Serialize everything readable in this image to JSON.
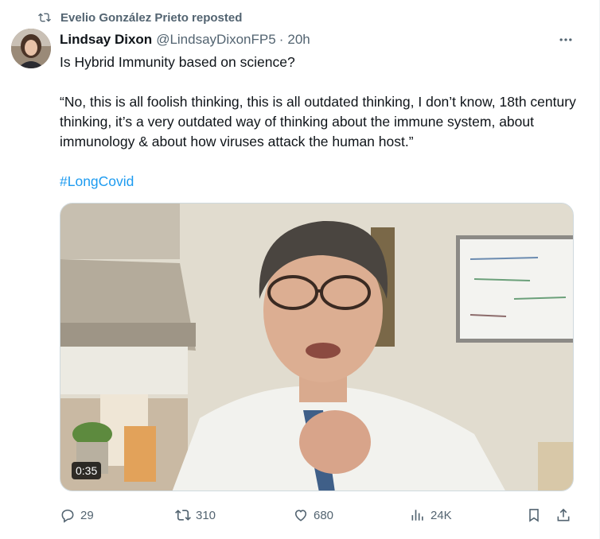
{
  "repost": {
    "text": "Evelio González Prieto reposted",
    "icon": "repost-icon"
  },
  "author": {
    "name": "Lindsay Dixon",
    "handle": "@LindsayDixonFP5",
    "separator": "·",
    "time": "20h"
  },
  "more_icon": "more-horizontal-icon",
  "tweet": {
    "line1": "Is Hybrid Immunity based on science?",
    "quote": "“No, this is all foolish thinking, this is all outdated thinking, I don’t know, 18th century thinking, it’s a very outdated way of thinking about the immune system, about immunology & about how viruses attack the human host.”",
    "hashtag": "#LongCovid"
  },
  "media": {
    "duration": "0:35"
  },
  "actions": {
    "replies": "29",
    "reposts": "310",
    "likes": "680",
    "views": "24K"
  },
  "colors": {
    "link": "#1d9bf0",
    "muted": "#536471",
    "text": "#0f1419"
  }
}
